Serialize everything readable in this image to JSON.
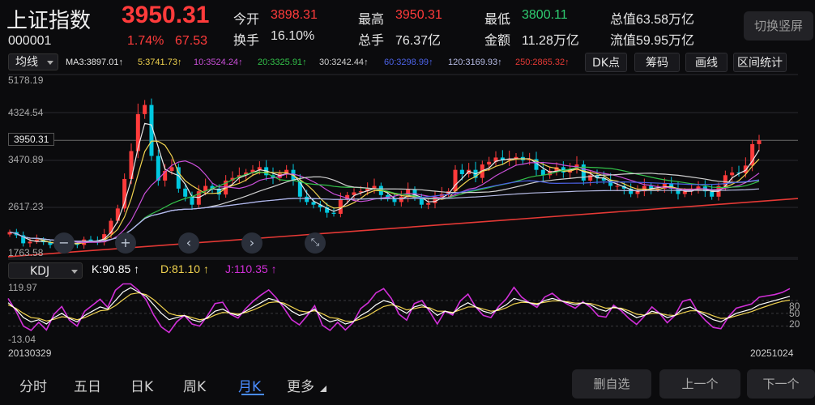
{
  "header": {
    "name": "上证指数",
    "price": "3950.31",
    "code": "000001",
    "change_pct": "1.74%",
    "change_amt": "67.53",
    "stats": [
      {
        "label": "今开",
        "value": "3898.31",
        "color": "red"
      },
      {
        "label": "最高",
        "value": "3950.31",
        "color": "red"
      },
      {
        "label": "最低",
        "value": "3800.11",
        "color": "green"
      },
      {
        "label": "总值",
        "value": "63.58万亿",
        "color": "white"
      },
      {
        "label": "换手",
        "value": "16.10%",
        "color": "white"
      },
      {
        "label": "总手",
        "value": "76.37亿",
        "color": "white"
      },
      {
        "label": "金额",
        "value": "11.28万亿",
        "color": "white"
      },
      {
        "label": "流值",
        "value": "59.95万亿",
        "color": "white"
      }
    ],
    "switch_label": "切换竖屏"
  },
  "toolbar": {
    "indicator": "均线",
    "ma": [
      {
        "label": "MA3:3897.01",
        "color": "#e8e8e8"
      },
      {
        "label": "5:3741.73",
        "color": "#f1d34f"
      },
      {
        "label": "10:3524.24",
        "color": "#c94fd8"
      },
      {
        "label": "20:3325.91",
        "color": "#33c24a"
      },
      {
        "label": "30:3242.44",
        "color": "#d0d0d0"
      },
      {
        "label": "60:3298.99",
        "color": "#4c62e6"
      },
      {
        "label": "120:3169.93",
        "color": "#b7bce6"
      },
      {
        "label": "250:2865.32",
        "color": "#e53935"
      }
    ],
    "buttons": [
      "DK点",
      "筹码",
      "画线",
      "区间统计"
    ]
  },
  "price_axis": [
    "5178.19",
    "4324.54",
    "3950.31",
    "3470.89",
    "2617.23",
    "1763.58"
  ],
  "kdj": {
    "label": "KDJ",
    "k": "K:90.85",
    "d": "D:81.10",
    "j": "J:110.35",
    "axis_left": [
      "119.97",
      "-13.04"
    ],
    "axis_right": [
      "80",
      "50",
      "20"
    ]
  },
  "dates": {
    "start": "20130329",
    "end": "20251024"
  },
  "tabs": [
    "分时",
    "五日",
    "日K",
    "周K",
    "月K",
    "更多"
  ],
  "active_tab": "月K",
  "bottom_buttons": [
    "删自选",
    "上一个",
    "下一个"
  ],
  "colors": {
    "up": "#ff3b3b",
    "down": "#00c8e0",
    "k_line": "#ffffff",
    "d_line": "#f1d34f",
    "j_line": "#d12fd8",
    "accent": "#4a8cff"
  },
  "chart_data": {
    "type": "candlestick",
    "x_start": "20130329",
    "x_end": "20251024",
    "ylim": [
      1763.58,
      5178.19
    ],
    "close_series": [
      2240,
      2180,
      2030,
      2060,
      2100,
      2050,
      2000,
      2010,
      2060,
      2030,
      2000,
      2100,
      2080,
      2050,
      2200,
      2450,
      2680,
      3230,
      3750,
      4440,
      4610,
      3660,
      3200,
      3380,
      3450,
      3050,
      2900,
      2750,
      3000,
      3100,
      3050,
      2940,
      3200,
      3250,
      3300,
      3350,
      3400,
      3450,
      3300,
      3250,
      3330,
      3400,
      3200,
      2900,
      2800,
      2750,
      2700,
      2600,
      2580,
      2850,
      2930,
      2980,
      3000,
      3050,
      3100,
      2930,
      2870,
      2800,
      2900,
      3030,
      2880,
      2750,
      2780,
      2900,
      2950,
      3000,
      3400,
      3320,
      3400,
      3250,
      3500,
      3550,
      3630,
      3580,
      3600,
      3640,
      3580,
      3600,
      3400,
      3300,
      3380,
      3450,
      3350,
      3400,
      3500,
      3200,
      3300,
      3250,
      3200,
      3100,
      3100,
      3050,
      2950,
      3000,
      3100,
      3050,
      3050,
      3150,
      3050,
      2950,
      3000,
      3050,
      3090,
      3000,
      2900,
      3100,
      3300,
      3350,
      3340,
      3480,
      3880,
      3950
    ],
    "k": [
      75,
      60,
      40,
      30,
      35,
      25,
      40,
      50,
      38,
      30,
      45,
      55,
      65,
      60,
      80,
      100,
      110,
      100,
      90,
      70,
      50,
      35,
      40,
      45,
      35,
      30,
      40,
      55,
      60,
      50,
      45,
      55,
      65,
      75,
      85,
      80,
      70,
      55,
      45,
      50,
      60,
      40,
      30,
      35,
      25,
      30,
      45,
      55,
      70,
      80,
      75,
      60,
      50,
      65,
      70,
      60,
      45,
      55,
      50,
      65,
      75,
      65,
      55,
      50,
      60,
      70,
      85,
      80,
      75,
      70,
      80,
      85,
      80,
      75,
      70,
      75,
      70,
      60,
      55,
      65,
      60,
      50,
      40,
      45,
      55,
      50,
      40,
      45,
      60,
      65,
      55,
      45,
      35,
      30,
      40,
      50,
      55,
      60,
      70,
      75,
      80,
      85,
      90
    ],
    "d": [
      70,
      62,
      50,
      40,
      38,
      32,
      36,
      42,
      40,
      35,
      40,
      48,
      56,
      58,
      68,
      82,
      95,
      98,
      94,
      82,
      66,
      50,
      45,
      45,
      40,
      35,
      38,
      46,
      52,
      51,
      48,
      52,
      58,
      66,
      75,
      77,
      74,
      65,
      56,
      53,
      56,
      49,
      40,
      38,
      32,
      31,
      37,
      45,
      56,
      66,
      70,
      66,
      58,
      61,
      65,
      63,
      55,
      55,
      52,
      58,
      65,
      65,
      60,
      55,
      57,
      63,
      72,
      76,
      75,
      73,
      76,
      79,
      79,
      77,
      74,
      74,
      73,
      68,
      62,
      63,
      62,
      56,
      48,
      46,
      50,
      50,
      46,
      45,
      51,
      56,
      56,
      51,
      44,
      38,
      39,
      44,
      49,
      54,
      61,
      67,
      73,
      78,
      81
    ]
  }
}
